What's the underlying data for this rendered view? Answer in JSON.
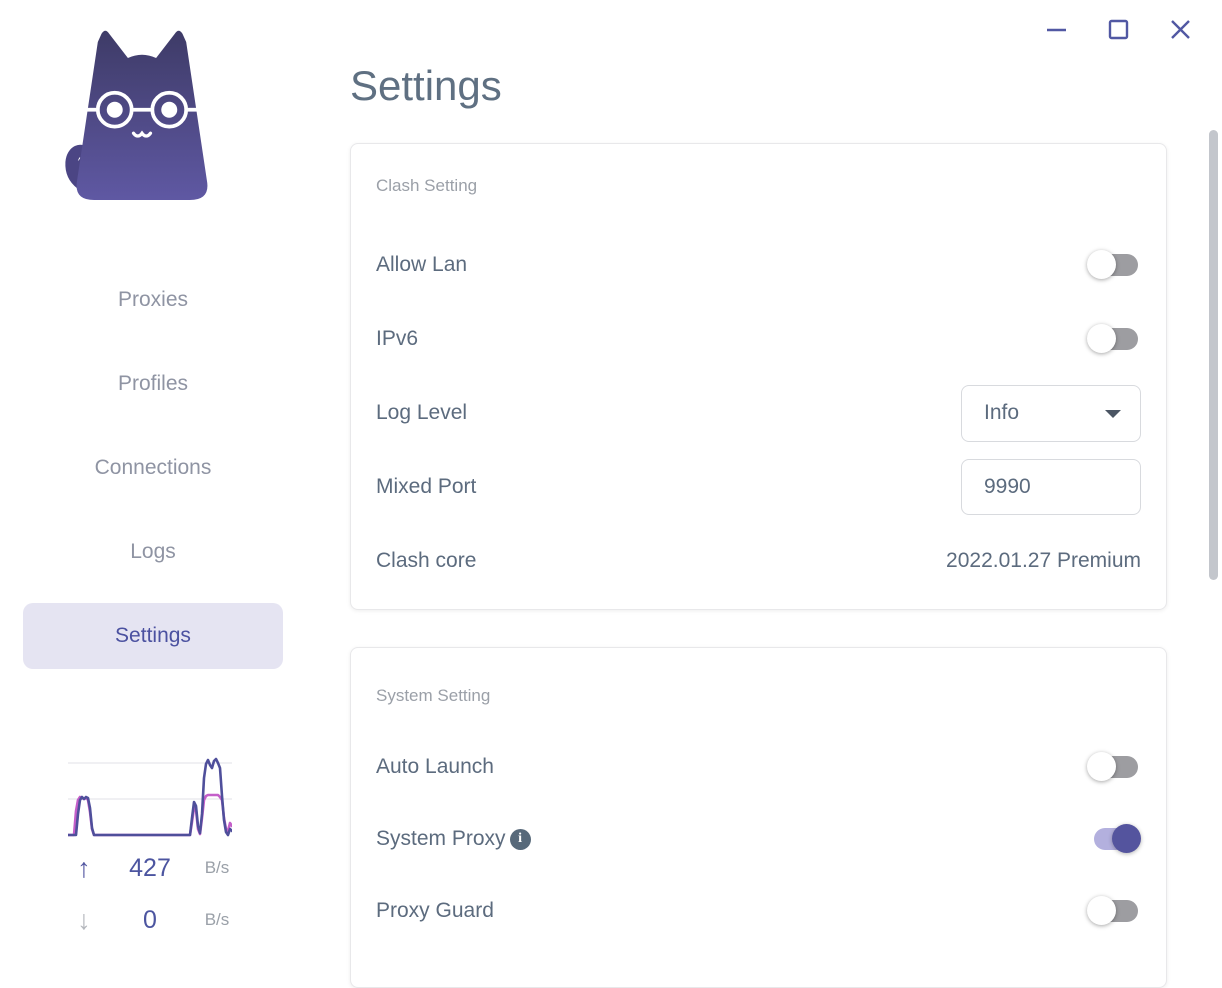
{
  "window_controls": [
    "minimize",
    "maximize",
    "close"
  ],
  "colors": {
    "accent": "#5458a2",
    "nav_selected_bg": "#e5e4f2",
    "nav_selected_text": "#4b51a0",
    "toggle_off_track": "#9d9da1",
    "toggle_on_track": "#b3b0de",
    "toggle_on_thumb": "#54549e",
    "upload_line": "#4f4f9b",
    "download_line": "#c45fc9",
    "text_primary": "#5c6b7e",
    "text_muted": "#9ba0a8"
  },
  "icons": {
    "info_glyph": "i"
  },
  "sidebar": {
    "logo": "clash-cat-logo",
    "nav": [
      {
        "label": "Proxies",
        "active": false
      },
      {
        "label": "Profiles",
        "active": false
      },
      {
        "label": "Connections",
        "active": false
      },
      {
        "label": "Logs",
        "active": false
      },
      {
        "label": "Settings",
        "active": true
      }
    ],
    "traffic": {
      "upload": {
        "icon": "arrow-up-icon",
        "arrow": "↑",
        "value": "427",
        "unit": "B/s"
      },
      "download": {
        "icon": "arrow-down-icon",
        "arrow": "↓",
        "value": "0",
        "unit": "B/s"
      }
    }
  },
  "chart_data": {
    "type": "line",
    "title": "traffic-sparkline",
    "xlabel": "",
    "ylabel": "",
    "x_range": [
      0,
      164
    ],
    "y_range": [
      0,
      82
    ],
    "baseline_y": 79,
    "gridlines_y": [
      7,
      43
    ],
    "grid": true,
    "legend_position": "none",
    "series": [
      {
        "name": "upload",
        "color": "#4f4f9b",
        "points": [
          [
            0,
            79
          ],
          [
            8,
            79
          ],
          [
            10,
            58
          ],
          [
            12,
            44
          ],
          [
            14,
            41
          ],
          [
            16,
            43
          ],
          [
            18,
            41
          ],
          [
            20,
            42
          ],
          [
            22,
            52
          ],
          [
            24,
            72
          ],
          [
            26,
            79
          ],
          [
            122,
            79
          ],
          [
            124,
            62
          ],
          [
            126,
            46
          ],
          [
            128,
            50
          ],
          [
            130,
            70
          ],
          [
            132,
            77
          ],
          [
            134,
            58
          ],
          [
            136,
            22
          ],
          [
            138,
            8
          ],
          [
            140,
            4
          ],
          [
            142,
            9
          ],
          [
            144,
            12
          ],
          [
            146,
            5
          ],
          [
            148,
            3
          ],
          [
            150,
            7
          ],
          [
            152,
            12
          ],
          [
            154,
            40
          ],
          [
            156,
            64
          ],
          [
            158,
            76
          ],
          [
            160,
            79
          ],
          [
            162,
            73
          ],
          [
            164,
            75
          ]
        ]
      },
      {
        "name": "download",
        "color": "#c45fc9",
        "points": [
          [
            0,
            79
          ],
          [
            6,
            79
          ],
          [
            8,
            55
          ],
          [
            10,
            44
          ],
          [
            12,
            41
          ],
          [
            14,
            42
          ],
          [
            16,
            43
          ],
          [
            18,
            42
          ],
          [
            20,
            44
          ],
          [
            22,
            56
          ],
          [
            24,
            73
          ],
          [
            26,
            79
          ],
          [
            122,
            79
          ],
          [
            124,
            66
          ],
          [
            126,
            52
          ],
          [
            128,
            54
          ],
          [
            130,
            73
          ],
          [
            132,
            78
          ],
          [
            134,
            62
          ],
          [
            136,
            44
          ],
          [
            138,
            40
          ],
          [
            140,
            39
          ],
          [
            150,
            39
          ],
          [
            152,
            41
          ],
          [
            154,
            44
          ],
          [
            156,
            62
          ],
          [
            158,
            73
          ],
          [
            160,
            75
          ],
          [
            162,
            67
          ],
          [
            164,
            70
          ]
        ]
      }
    ]
  },
  "main": {
    "title": "Settings",
    "cards": [
      {
        "header": "Clash Setting",
        "rows": [
          {
            "label": "Allow Lan",
            "control": "toggle",
            "state": "off"
          },
          {
            "label": "IPv6",
            "control": "toggle",
            "state": "off"
          },
          {
            "label": "Log Level",
            "control": "select",
            "value": "Info"
          },
          {
            "label": "Mixed Port",
            "control": "input",
            "value": "9990"
          },
          {
            "label": "Clash core",
            "control": "text",
            "value": "2022.01.27 Premium"
          }
        ]
      },
      {
        "header": "System Setting",
        "rows": [
          {
            "label": "Auto Launch",
            "control": "toggle",
            "state": "off"
          },
          {
            "label": "System Proxy",
            "control": "toggle",
            "state": "on",
            "info_icon": true
          },
          {
            "label": "Proxy Guard",
            "control": "toggle",
            "state": "off"
          }
        ]
      }
    ]
  }
}
